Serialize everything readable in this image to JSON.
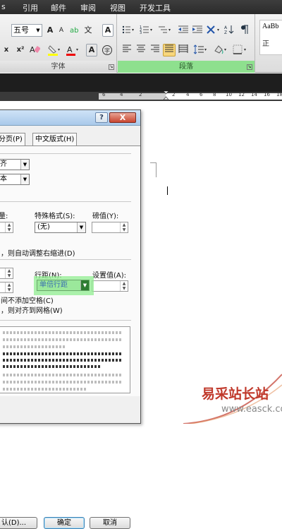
{
  "ribbon": {
    "tabs": [
      "引用",
      "邮件",
      "审阅",
      "视图",
      "开发工具"
    ],
    "font_group": {
      "size_value": "五号",
      "label": "字体",
      "buttons_row1": [
        "A",
        "A",
        "A",
        "A"
      ],
      "buttons_row2": [
        "x",
        "x²",
        "A"
      ],
      "button_wen": "文"
    },
    "paragraph_group": {
      "label": "段落"
    },
    "styles_group": {
      "preview_text": "AaBb",
      "sample_char": "正"
    }
  },
  "ruler": {
    "numbers": [
      "6",
      "4",
      "2",
      "2",
      "4",
      "6",
      "8",
      "10",
      "12",
      "14",
      "16",
      "18"
    ]
  },
  "dialog": {
    "help_label": "?",
    "close_label": "X",
    "tabs": [
      "分页(P)",
      "中文版式(H)"
    ],
    "alignment_value": "齐",
    "outline_value": "本",
    "indent_left_label": "量:",
    "special_label": "特殊格式(S):",
    "special_value": "(无)",
    "indent_value_label": "磅值(Y):",
    "auto_indent_text": "，则自动调整右缩进(D)",
    "line_spacing_label": "行距(N):",
    "line_spacing_value": "单倍行距",
    "set_value_label": "设置值(A):",
    "no_space_text": "间不添加空格(C)",
    "grid_text": "，则对齐到网格(W)",
    "buttons": {
      "default": "认(D)...",
      "ok": "确定",
      "cancel": "取消"
    }
  },
  "watermark": {
    "cn": "易采站长站",
    "en": "www.easck.com"
  },
  "colors": {
    "highlight": "#90ee90",
    "paragraph_group": "#8ee08e",
    "watermark": "#c0392b"
  }
}
